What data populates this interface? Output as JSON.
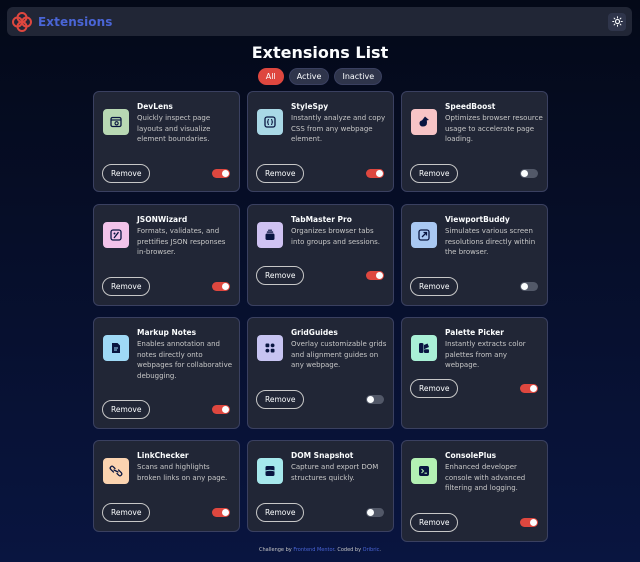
{
  "header": {
    "logo_text": "Extensions",
    "theme_icon": "sun-icon"
  },
  "main": {
    "title": "Extensions List",
    "filters": [
      {
        "label": "All",
        "active": true
      },
      {
        "label": "Active",
        "active": false
      },
      {
        "label": "Inactive",
        "active": false
      }
    ],
    "remove_label": "Remove"
  },
  "extensions": [
    {
      "name": "DevLens",
      "description": "Quickly inspect page layouts and visualize element boundaries.",
      "active": true,
      "icon": "devlens-icon",
      "icon_bg": "#b8d8b3"
    },
    {
      "name": "StyleSpy",
      "description": "Instantly analyze and copy CSS from any webpage element.",
      "active": true,
      "icon": "stylespy-icon",
      "icon_bg": "#a9d8e6"
    },
    {
      "name": "SpeedBoost",
      "description": "Optimizes browser resource usage to accelerate page loading.",
      "active": false,
      "icon": "speedboost-icon",
      "icon_bg": "#f7c4c6"
    },
    {
      "name": "JSONWizard",
      "description": "Formats, validates, and prettifies JSON responses in-browser.",
      "active": true,
      "icon": "jsonwizard-icon",
      "icon_bg": "#f2c3ea"
    },
    {
      "name": "TabMaster Pro",
      "description": "Organizes browser tabs into groups and sessions.",
      "active": true,
      "icon": "tabmaster-icon",
      "icon_bg": "#cfc2f2"
    },
    {
      "name": "ViewportBuddy",
      "description": "Simulates various screen resolutions directly within the browser.",
      "active": false,
      "icon": "viewportbuddy-icon",
      "icon_bg": "#a9c8f2"
    },
    {
      "name": "Markup Notes",
      "description": "Enables annotation and notes directly onto webpages for collaborative debugging.",
      "active": true,
      "icon": "markupnotes-icon",
      "icon_bg": "#9fd9f6"
    },
    {
      "name": "GridGuides",
      "description": "Overlay customizable grids and alignment guides on any webpage.",
      "active": false,
      "icon": "gridguides-icon",
      "icon_bg": "#c7c4f2"
    },
    {
      "name": "Palette Picker",
      "description": "Instantly extracts color palettes from any webpage.",
      "active": true,
      "icon": "palettepicker-icon",
      "icon_bg": "#a9f0d6"
    },
    {
      "name": "LinkChecker",
      "description": "Scans and highlights broken links on any page.",
      "active": true,
      "icon": "linkchecker-icon",
      "icon_bg": "#fbd3b0"
    },
    {
      "name": "DOM Snapshot",
      "description": "Capture and export DOM structures quickly.",
      "active": false,
      "icon": "domsnapshot-icon",
      "icon_bg": "#a6e8ec"
    },
    {
      "name": "ConsolePlus",
      "description": "Enhanced developer console with advanced filtering and logging.",
      "active": true,
      "icon": "consoleplus-icon",
      "icon_bg": "#b3f0b3"
    }
  ],
  "footer": {
    "prefix": "Challenge by",
    "challenge_link": "Frontend Mentor",
    "middle": ". Coded by",
    "author_link": "Oribric",
    "suffix": "."
  },
  "colors": {
    "accent": "#de473f",
    "brand": "#4a65d6",
    "card_bg": "#212636"
  }
}
